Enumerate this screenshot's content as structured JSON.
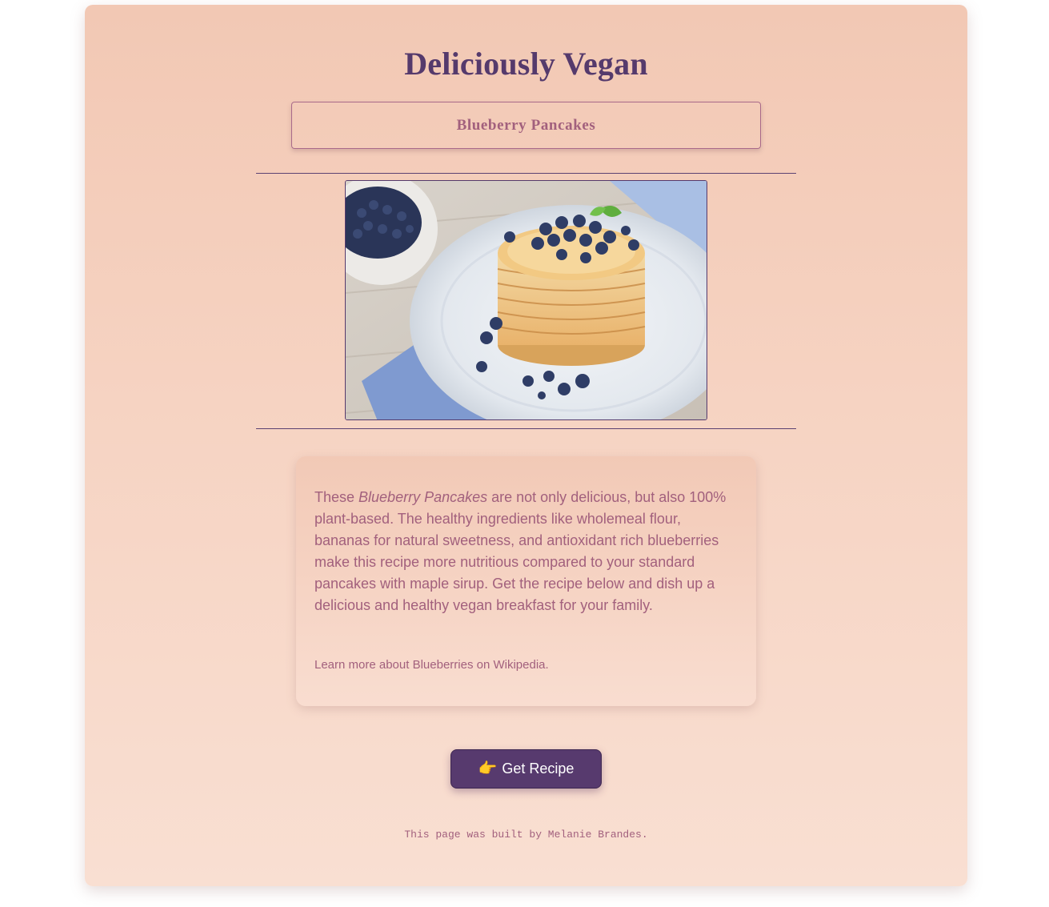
{
  "header": {
    "title": "Deliciously Vegan",
    "subtitle": "Blueberry Pancakes"
  },
  "image": {
    "alt": "Blueberry Pancakes"
  },
  "description": {
    "intro": "These ",
    "dish_name": "Blueberry Pancakes",
    "body": " are not only delicious, but also 100% plant-based. The healthy ingredients like wholemeal flour, bananas for natural sweetness, and antioxidant rich blueberries make this recipe more nutritious compared to your standard pancakes with maple sirup. Get the recipe below and dish up a delicious and healthy vegan breakfast for your family.",
    "learn_more_prefix": "Learn more about ",
    "learn_more_link": "Blueberries on Wikipedia",
    "learn_more_suffix": "."
  },
  "button": {
    "icon": "pointing-hand-icon",
    "label": "Get Recipe"
  },
  "footer": {
    "text": "This page was built by Melanie Brandes."
  },
  "colors": {
    "title": "#553a6c",
    "accent_text": "#a2607d",
    "button_bg": "#573a6e",
    "card_top": "#f2c8b4",
    "card_bottom": "#f9dfd2"
  }
}
